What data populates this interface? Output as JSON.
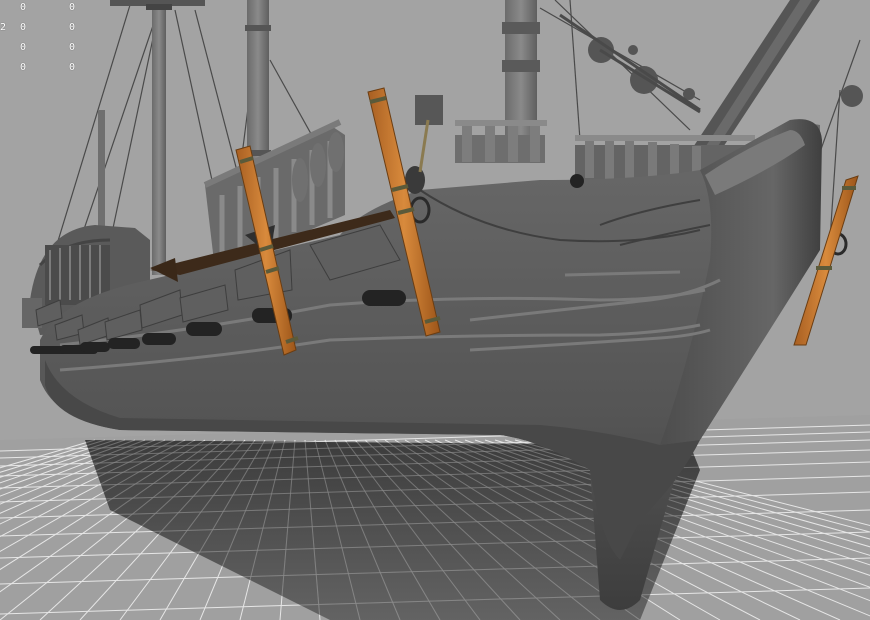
{
  "viewport": {
    "background_color": "#a3a3a3",
    "grid_color": "#e6e6e6",
    "ship_hull_color": "#5d5d5d",
    "wood_color": "#c8782e",
    "shading_mode": "smooth shaded with textures",
    "grid_visible": true
  },
  "hud": {
    "rows": [
      {
        "label": "",
        "col1": "0",
        "col2": "0"
      },
      {
        "label": "2",
        "col1": "0",
        "col2": "0"
      },
      {
        "label": "",
        "col1": "0",
        "col2": "0"
      },
      {
        "label": "",
        "col1": "0",
        "col2": "0"
      }
    ]
  },
  "scene": {
    "objects": [
      "ship-hull",
      "masts",
      "rigging",
      "cannons",
      "wooden-catheads",
      "anchor",
      "ground-grid"
    ]
  }
}
